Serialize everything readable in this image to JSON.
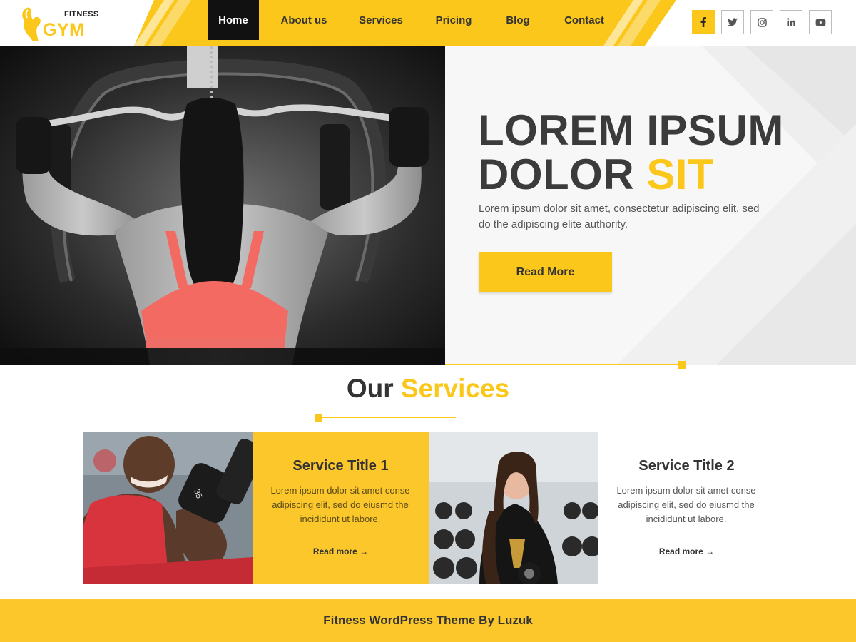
{
  "brand": {
    "small": "FITNESS",
    "big": "GYM",
    "accent": "#fbc71b"
  },
  "nav": {
    "items": [
      {
        "label": "Home",
        "active": true
      },
      {
        "label": "About us"
      },
      {
        "label": "Services"
      },
      {
        "label": "Pricing"
      },
      {
        "label": "Blog"
      },
      {
        "label": "Contact"
      }
    ]
  },
  "social": [
    {
      "icon": "facebook-icon"
    },
    {
      "icon": "twitter-icon"
    },
    {
      "icon": "instagram-icon"
    },
    {
      "icon": "linkedin-icon"
    },
    {
      "icon": "youtube-icon"
    }
  ],
  "hero": {
    "title_line1": "LOREM IPSUM",
    "title_line2": "DOLOR",
    "title_highlight": "SIT",
    "text": "Lorem ipsum dolor sit amet, consectetur adipiscing elit, sed do the adipiscing elite authority.",
    "button": "Read More"
  },
  "services": {
    "heading": "Our",
    "heading_highlight": "Services",
    "items": [
      {
        "title": "Service Title 1",
        "text": "Lorem ipsum dolor sit amet conse adipiscing elit, sed do eiusmd the incididunt ut labore.",
        "more": "Read more",
        "arrow": "→"
      },
      {
        "title": "Service Title 2",
        "text": "Lorem ipsum dolor sit amet conse adipiscing elit, sed do eiusmd the incididunt ut labore.",
        "more": "Read more",
        "arrow": "→"
      }
    ]
  },
  "footer": {
    "text": "Fitness WordPress Theme By Luzuk"
  }
}
